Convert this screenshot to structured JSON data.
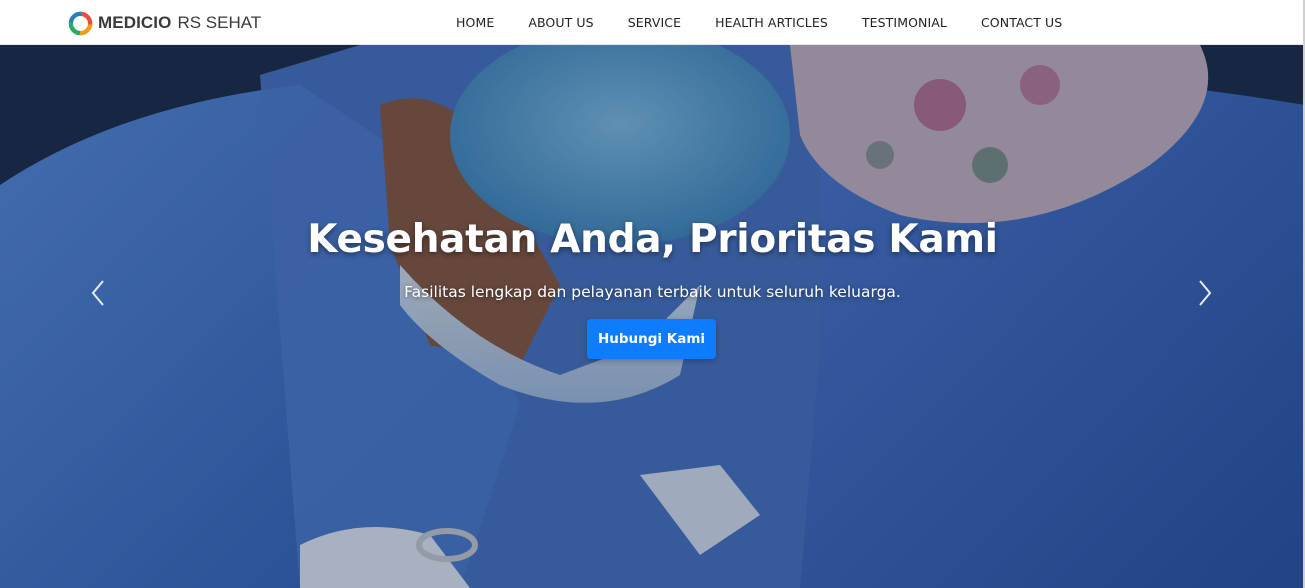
{
  "brand": {
    "name": "MEDICIO",
    "subtitle": "RS SEHAT",
    "logo_icon": "ring-logo-icon",
    "logo_colors": [
      "#f39c12",
      "#27ae60",
      "#2980b9",
      "#e74c3c"
    ]
  },
  "nav": {
    "items": [
      {
        "label": "HOME"
      },
      {
        "label": "ABOUT US"
      },
      {
        "label": "SERVICE"
      },
      {
        "label": "HEALTH ARTICLES"
      },
      {
        "label": "TESTIMONIAL"
      },
      {
        "label": "CONTACT US"
      }
    ]
  },
  "hero": {
    "title": "Kesehatan Anda, Prioritas Kami",
    "subtitle": "Fasilitas lengkap dan pelayanan terbaik untuk seluruh keluarga.",
    "cta_label": "Hubungi Kami",
    "prev_icon": "chevron-left-icon",
    "next_icon": "chevron-right-icon",
    "background_image": "surgeons-operating-room-photo"
  },
  "colors": {
    "accent": "#0d7cff",
    "nav_text": "#222222",
    "hero_text": "#ffffff"
  }
}
